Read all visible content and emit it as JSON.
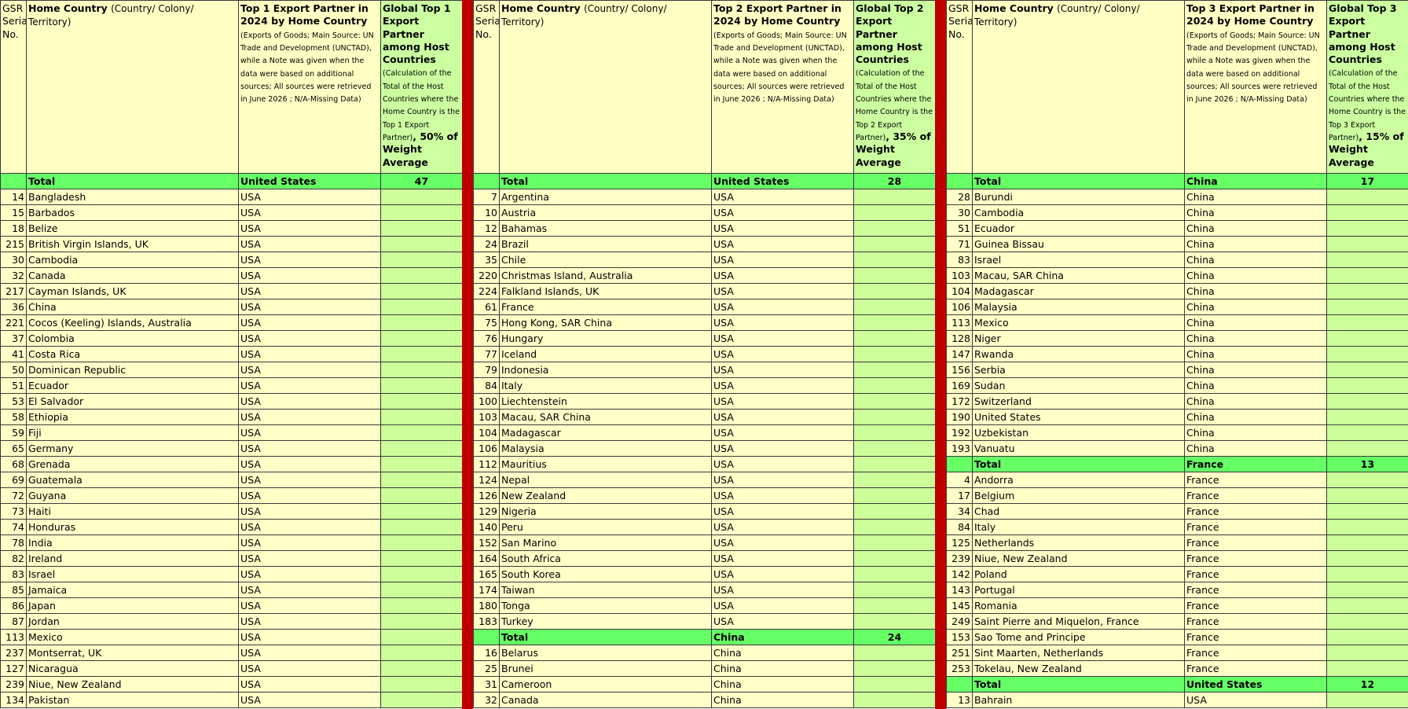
{
  "groups": [
    {
      "header": {
        "serial": "GSR Serial No.",
        "country_main": "Home Country",
        "country_sub": "(Country/ Colony/ Territory)",
        "partner_main": "Top 1 Export Partner in 2024 by Home Country",
        "partner_sub": "(Exports of Goods; Main Source: UN Trade and Development (UNCTAD), while a Note was given when the data were based on additional sources; All sources were retrieved in June 2026 ; N/A-Missing Data)",
        "global_main": "Global Top 1 Export Partner among Host Countries",
        "global_sub": "(Calculation of the Total of the Host Countries where the Home Country is the Top 1 Export Partner)",
        "global_weight": ", 50% of Weight Average"
      },
      "rows": [
        {
          "type": "total",
          "serial": "",
          "country": "Total",
          "partner": "United States",
          "global": "47"
        },
        {
          "type": "row",
          "serial": "14",
          "country": "Bangladesh",
          "partner": "USA",
          "global": ""
        },
        {
          "type": "row",
          "serial": "15",
          "country": "Barbados",
          "partner": "USA",
          "global": ""
        },
        {
          "type": "row",
          "serial": "18",
          "country": "Belize",
          "partner": "USA",
          "global": ""
        },
        {
          "type": "row",
          "serial": "215",
          "country": "British Virgin Islands, UK",
          "partner": "USA",
          "global": ""
        },
        {
          "type": "row",
          "serial": "30",
          "country": "Cambodia",
          "partner": "USA",
          "global": ""
        },
        {
          "type": "row",
          "serial": "32",
          "country": "Canada",
          "partner": "USA",
          "global": ""
        },
        {
          "type": "row",
          "serial": "217",
          "country": "Cayman Islands, UK",
          "partner": "USA",
          "global": ""
        },
        {
          "type": "row",
          "serial": "36",
          "country": "China",
          "partner": "USA",
          "global": ""
        },
        {
          "type": "row",
          "serial": "221",
          "country": "Cocos (Keeling) Islands, Australia",
          "partner": "USA",
          "global": ""
        },
        {
          "type": "row",
          "serial": "37",
          "country": "Colombia",
          "partner": "USA",
          "global": ""
        },
        {
          "type": "row",
          "serial": "41",
          "country": "Costa Rica",
          "partner": "USA",
          "global": ""
        },
        {
          "type": "row",
          "serial": "50",
          "country": "Dominican Republic",
          "partner": "USA",
          "global": ""
        },
        {
          "type": "row",
          "serial": "51",
          "country": "Ecuador",
          "partner": "USA",
          "global": ""
        },
        {
          "type": "row",
          "serial": "53",
          "country": "El Salvador",
          "partner": "USA",
          "global": ""
        },
        {
          "type": "row",
          "serial": "58",
          "country": "Ethiopia",
          "partner": "USA",
          "global": ""
        },
        {
          "type": "row",
          "serial": "59",
          "country": "Fiji",
          "partner": "USA",
          "global": ""
        },
        {
          "type": "row",
          "serial": "65",
          "country": "Germany",
          "partner": "USA",
          "global": ""
        },
        {
          "type": "row",
          "serial": "68",
          "country": "Grenada",
          "partner": "USA",
          "global": ""
        },
        {
          "type": "row",
          "serial": "69",
          "country": "Guatemala",
          "partner": "USA",
          "global": ""
        },
        {
          "type": "row",
          "serial": "72",
          "country": "Guyana",
          "partner": "USA",
          "global": ""
        },
        {
          "type": "row",
          "serial": "73",
          "country": "Haiti",
          "partner": "USA",
          "global": ""
        },
        {
          "type": "row",
          "serial": "74",
          "country": "Honduras",
          "partner": "USA",
          "global": ""
        },
        {
          "type": "row",
          "serial": "78",
          "country": "India",
          "partner": "USA",
          "global": ""
        },
        {
          "type": "row",
          "serial": "82",
          "country": "Ireland",
          "partner": "USA",
          "global": ""
        },
        {
          "type": "row",
          "serial": "83",
          "country": "Israel",
          "partner": "USA",
          "global": ""
        },
        {
          "type": "row",
          "serial": "85",
          "country": "Jamaica",
          "partner": "USA",
          "global": ""
        },
        {
          "type": "row",
          "serial": "86",
          "country": "Japan",
          "partner": "USA",
          "global": ""
        },
        {
          "type": "row",
          "serial": "87",
          "country": "Jordan",
          "partner": "USA",
          "global": ""
        },
        {
          "type": "row",
          "serial": "113",
          "country": "Mexico",
          "partner": "USA",
          "global": ""
        },
        {
          "type": "row",
          "serial": "237",
          "country": "Montserrat, UK",
          "partner": "USA",
          "global": ""
        },
        {
          "type": "row",
          "serial": "127",
          "country": "Nicaragua",
          "partner": "USA",
          "global": ""
        },
        {
          "type": "row",
          "serial": "239",
          "country": "Niue, New Zealand",
          "partner": "USA",
          "global": ""
        },
        {
          "type": "row",
          "serial": "134",
          "country": "Pakistan",
          "partner": "USA",
          "global": ""
        }
      ]
    },
    {
      "header": {
        "serial": "GSR Serial No.",
        "country_main": "Home Country",
        "country_sub": "(Country/ Colony/ Territory)",
        "partner_main": "Top 2 Export Partner in 2024 by Home Country",
        "partner_sub": "(Exports of Goods; Main Source: UN Trade and Development (UNCTAD), while a Note was given when the data were based on additional sources; All sources were retrieved in June 2026 ; N/A-Missing Data)",
        "global_main": "Global Top 2 Export Partner among Host Countries",
        "global_sub": "(Calculation of the Total of the Host Countries where the Home Country is the Top 2 Export Partner)",
        "global_weight": ", 35% of Weight Average"
      },
      "rows": [
        {
          "type": "total",
          "serial": "",
          "country": "Total",
          "partner": "United States",
          "global": "28"
        },
        {
          "type": "row",
          "serial": "7",
          "country": "Argentina",
          "partner": "USA",
          "global": ""
        },
        {
          "type": "row",
          "serial": "10",
          "country": "Austria",
          "partner": "USA",
          "global": ""
        },
        {
          "type": "row",
          "serial": "12",
          "country": "Bahamas",
          "partner": "USA",
          "global": ""
        },
        {
          "type": "row",
          "serial": "24",
          "country": "Brazil",
          "partner": "USA",
          "global": ""
        },
        {
          "type": "row",
          "serial": "35",
          "country": "Chile",
          "partner": "USA",
          "global": ""
        },
        {
          "type": "row",
          "serial": "220",
          "country": "Christmas Island, Australia",
          "partner": "USA",
          "global": ""
        },
        {
          "type": "row",
          "serial": "224",
          "country": "Falkland Islands, UK",
          "partner": "USA",
          "global": ""
        },
        {
          "type": "row",
          "serial": "61",
          "country": "France",
          "partner": "USA",
          "global": ""
        },
        {
          "type": "row",
          "serial": "75",
          "country": "Hong Kong, SAR China",
          "partner": "USA",
          "global": ""
        },
        {
          "type": "row",
          "serial": "76",
          "country": "Hungary",
          "partner": "USA",
          "global": ""
        },
        {
          "type": "row",
          "serial": "77",
          "country": "Iceland",
          "partner": "USA",
          "global": ""
        },
        {
          "type": "row",
          "serial": "79",
          "country": "Indonesia",
          "partner": "USA",
          "global": ""
        },
        {
          "type": "row",
          "serial": "84",
          "country": "Italy",
          "partner": "USA",
          "global": ""
        },
        {
          "type": "row",
          "serial": "100",
          "country": "Liechtenstein",
          "partner": "USA",
          "global": ""
        },
        {
          "type": "row",
          "serial": "103",
          "country": "Macau, SAR China",
          "partner": "USA",
          "global": ""
        },
        {
          "type": "row",
          "serial": "104",
          "country": "Madagascar",
          "partner": "USA",
          "global": ""
        },
        {
          "type": "row",
          "serial": "106",
          "country": "Malaysia",
          "partner": "USA",
          "global": ""
        },
        {
          "type": "row",
          "serial": "112",
          "country": "Mauritius",
          "partner": "USA",
          "global": ""
        },
        {
          "type": "row",
          "serial": "124",
          "country": "Nepal",
          "partner": "USA",
          "global": ""
        },
        {
          "type": "row",
          "serial": "126",
          "country": "New Zealand",
          "partner": "USA",
          "global": ""
        },
        {
          "type": "row",
          "serial": "129",
          "country": "Nigeria",
          "partner": "USA",
          "global": ""
        },
        {
          "type": "row",
          "serial": "140",
          "country": "Peru",
          "partner": "USA",
          "global": ""
        },
        {
          "type": "row",
          "serial": "152",
          "country": "San Marino",
          "partner": "USA",
          "global": ""
        },
        {
          "type": "row",
          "serial": "164",
          "country": "South Africa",
          "partner": "USA",
          "global": ""
        },
        {
          "type": "row",
          "serial": "165",
          "country": "South Korea",
          "partner": "USA",
          "global": ""
        },
        {
          "type": "row",
          "serial": "174",
          "country": "Taiwan",
          "partner": "USA",
          "global": ""
        },
        {
          "type": "row",
          "serial": "180",
          "country": "Tonga",
          "partner": "USA",
          "global": ""
        },
        {
          "type": "row",
          "serial": "183",
          "country": "Turkey",
          "partner": "USA",
          "global": ""
        },
        {
          "type": "total",
          "serial": "",
          "country": "Total",
          "partner": "China",
          "global": "24"
        },
        {
          "type": "row",
          "serial": "16",
          "country": "Belarus",
          "partner": "China",
          "global": ""
        },
        {
          "type": "row",
          "serial": "25",
          "country": "Brunei",
          "partner": "China",
          "global": ""
        },
        {
          "type": "row",
          "serial": "31",
          "country": "Cameroon",
          "partner": "China",
          "global": ""
        },
        {
          "type": "row",
          "serial": "32",
          "country": "Canada",
          "partner": "China",
          "global": ""
        }
      ]
    },
    {
      "header": {
        "serial": "GSR Serial No.",
        "country_main": "Home Country",
        "country_sub": "(Country/ Colony/ Territory)",
        "partner_main": "Top 3 Export Partner in 2024 by Home Country",
        "partner_sub": "(Exports of Goods; Main Source: UN Trade and Development (UNCTAD), while a Note was given when the data were based on additional sources; All sources were retrieved in June 2026 ; N/A-Missing Data)",
        "global_main": "Global Top 3 Export Partner among Host Countries",
        "global_sub": "(Calculation of the Total of the Host Countries where the Home Country is the Top 3 Export Partner)",
        "global_weight": ", 15% of Weight Average"
      },
      "rows": [
        {
          "type": "total",
          "serial": "",
          "country": "Total",
          "partner": "China",
          "global": "17"
        },
        {
          "type": "row",
          "serial": "28",
          "country": "Burundi",
          "partner": "China",
          "global": ""
        },
        {
          "type": "row",
          "serial": "30",
          "country": "Cambodia",
          "partner": "China",
          "global": ""
        },
        {
          "type": "row",
          "serial": "51",
          "country": "Ecuador",
          "partner": "China",
          "global": ""
        },
        {
          "type": "row",
          "serial": "71",
          "country": "Guinea Bissau",
          "partner": "China",
          "global": ""
        },
        {
          "type": "row",
          "serial": "83",
          "country": "Israel",
          "partner": "China",
          "global": ""
        },
        {
          "type": "row",
          "serial": "103",
          "country": "Macau, SAR China",
          "partner": "China",
          "global": ""
        },
        {
          "type": "row",
          "serial": "104",
          "country": "Madagascar",
          "partner": "China",
          "global": ""
        },
        {
          "type": "row",
          "serial": "106",
          "country": "Malaysia",
          "partner": "China",
          "global": ""
        },
        {
          "type": "row",
          "serial": "113",
          "country": "Mexico",
          "partner": "China",
          "global": ""
        },
        {
          "type": "row",
          "serial": "128",
          "country": "Niger",
          "partner": "China",
          "global": ""
        },
        {
          "type": "row",
          "serial": "147",
          "country": "Rwanda",
          "partner": "China",
          "global": ""
        },
        {
          "type": "row",
          "serial": "156",
          "country": "Serbia",
          "partner": "China",
          "global": ""
        },
        {
          "type": "row",
          "serial": "169",
          "country": "Sudan",
          "partner": "China",
          "global": ""
        },
        {
          "type": "row",
          "serial": "172",
          "country": "Switzerland",
          "partner": "China",
          "global": ""
        },
        {
          "type": "row",
          "serial": "190",
          "country": "United States",
          "partner": "China",
          "global": ""
        },
        {
          "type": "row",
          "serial": "192",
          "country": "Uzbekistan",
          "partner": "China",
          "global": ""
        },
        {
          "type": "row",
          "serial": "193",
          "country": "Vanuatu",
          "partner": "China",
          "global": ""
        },
        {
          "type": "total",
          "serial": "",
          "country": "Total",
          "partner": "France",
          "global": "13"
        },
        {
          "type": "row",
          "serial": "4",
          "country": "Andorra",
          "partner": "France",
          "global": ""
        },
        {
          "type": "row",
          "serial": "17",
          "country": "Belgium",
          "partner": "France",
          "global": ""
        },
        {
          "type": "row",
          "serial": "34",
          "country": "Chad",
          "partner": "France",
          "global": ""
        },
        {
          "type": "row",
          "serial": "84",
          "country": "Italy",
          "partner": "France",
          "global": ""
        },
        {
          "type": "row",
          "serial": "125",
          "country": "Netherlands",
          "partner": "France",
          "global": ""
        },
        {
          "type": "row",
          "serial": "239",
          "country": "Niue, New Zealand",
          "partner": "France",
          "global": ""
        },
        {
          "type": "row",
          "serial": "142",
          "country": "Poland",
          "partner": "France",
          "global": ""
        },
        {
          "type": "row",
          "serial": "143",
          "country": "Portugal",
          "partner": "France",
          "global": ""
        },
        {
          "type": "row",
          "serial": "145",
          "country": "Romania",
          "partner": "France",
          "global": ""
        },
        {
          "type": "row",
          "serial": "249",
          "country": "Saint Pierre and Miquelon, France",
          "partner": "France",
          "global": ""
        },
        {
          "type": "row",
          "serial": "153",
          "country": "Sao Tome and Principe",
          "partner": "France",
          "global": ""
        },
        {
          "type": "row",
          "serial": "251",
          "country": "Sint Maarten, Netherlands",
          "partner": "France",
          "global": ""
        },
        {
          "type": "row",
          "serial": "253",
          "country": "Tokelau, New Zealand",
          "partner": "France",
          "global": ""
        },
        {
          "type": "total",
          "serial": "",
          "country": "Total",
          "partner": "United States",
          "global": "12"
        },
        {
          "type": "row",
          "serial": "13",
          "country": "Bahrain",
          "partner": "USA",
          "global": ""
        }
      ]
    }
  ],
  "colors": {
    "header_yellow": "#ffffc4",
    "header_green": "#ccffa0",
    "total_green": "#66ff66",
    "cell_yellow": "#ffffc8",
    "cell_green": "#ccff99",
    "separator_red": "#c00000"
  }
}
